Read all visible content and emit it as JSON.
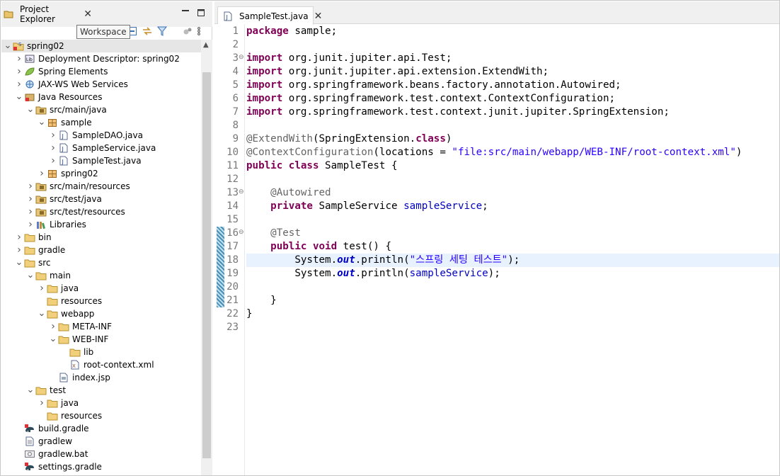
{
  "explorer": {
    "tab_label": "Project Explorer",
    "close_glyph": "✕",
    "tooltip": "Workspace",
    "tree": [
      {
        "label": "spring02",
        "depth": 0,
        "open": true,
        "icon": "project-icon",
        "selected": true
      },
      {
        "label": "Deployment Descriptor: spring02",
        "depth": 1,
        "open": false,
        "icon": "deployment-descriptor-icon"
      },
      {
        "label": "Spring Elements",
        "depth": 1,
        "open": false,
        "icon": "spring-leaf-icon"
      },
      {
        "label": "JAX-WS Web Services",
        "depth": 1,
        "open": false,
        "icon": "web-services-icon"
      },
      {
        "label": "Java Resources",
        "depth": 1,
        "open": true,
        "icon": "java-resources-icon"
      },
      {
        "label": "src/main/java",
        "depth": 2,
        "open": true,
        "icon": "source-folder-icon"
      },
      {
        "label": "sample",
        "depth": 3,
        "open": true,
        "icon": "package-icon"
      },
      {
        "label": "SampleDAO.java",
        "depth": 4,
        "open": false,
        "icon": "java-file-icon"
      },
      {
        "label": "SampleService.java",
        "depth": 4,
        "open": false,
        "icon": "java-file-icon"
      },
      {
        "label": "SampleTest.java",
        "depth": 4,
        "open": false,
        "icon": "java-file-icon"
      },
      {
        "label": "spring02",
        "depth": 3,
        "open": false,
        "icon": "package-icon"
      },
      {
        "label": "src/main/resources",
        "depth": 2,
        "open": false,
        "icon": "source-folder-icon"
      },
      {
        "label": "src/test/java",
        "depth": 2,
        "open": false,
        "icon": "source-folder-icon"
      },
      {
        "label": "src/test/resources",
        "depth": 2,
        "open": false,
        "icon": "source-folder-icon"
      },
      {
        "label": "Libraries",
        "depth": 2,
        "open": false,
        "icon": "libraries-icon"
      },
      {
        "label": "bin",
        "depth": 1,
        "open": false,
        "icon": "folder-icon"
      },
      {
        "label": "gradle",
        "depth": 1,
        "open": false,
        "icon": "folder-icon"
      },
      {
        "label": "src",
        "depth": 1,
        "open": true,
        "icon": "folder-icon"
      },
      {
        "label": "main",
        "depth": 2,
        "open": true,
        "icon": "folder-icon"
      },
      {
        "label": "java",
        "depth": 3,
        "open": false,
        "icon": "folder-icon"
      },
      {
        "label": "resources",
        "depth": 3,
        "leaf": true,
        "icon": "folder-icon"
      },
      {
        "label": "webapp",
        "depth": 3,
        "open": true,
        "icon": "folder-icon"
      },
      {
        "label": "META-INF",
        "depth": 4,
        "open": false,
        "icon": "folder-icon"
      },
      {
        "label": "WEB-INF",
        "depth": 4,
        "open": true,
        "icon": "folder-icon"
      },
      {
        "label": "lib",
        "depth": 5,
        "leaf": true,
        "icon": "folder-icon"
      },
      {
        "label": "root-context.xml",
        "depth": 5,
        "leaf": true,
        "icon": "xml-file-icon"
      },
      {
        "label": "index.jsp",
        "depth": 4,
        "leaf": true,
        "icon": "jsp-file-icon"
      },
      {
        "label": "test",
        "depth": 2,
        "open": true,
        "icon": "folder-icon"
      },
      {
        "label": "java",
        "depth": 3,
        "open": false,
        "icon": "folder-icon"
      },
      {
        "label": "resources",
        "depth": 3,
        "leaf": true,
        "icon": "folder-icon"
      },
      {
        "label": "build.gradle",
        "depth": 1,
        "leaf": true,
        "icon": "gradle-file-icon"
      },
      {
        "label": "gradlew",
        "depth": 1,
        "leaf": true,
        "icon": "text-file-icon"
      },
      {
        "label": "gradlew.bat",
        "depth": 1,
        "leaf": true,
        "icon": "bat-file-icon"
      },
      {
        "label": "settings.gradle",
        "depth": 1,
        "leaf": true,
        "icon": "gradle-file-icon"
      }
    ]
  },
  "editor": {
    "tab_label": "SampleTest.java",
    "close_glyph": "✕",
    "current_line": 18,
    "lines": [
      {
        "n": "1",
        "parts": [
          [
            "kw",
            "package"
          ],
          [
            "t",
            " sample;"
          ]
        ]
      },
      {
        "n": "2",
        "parts": []
      },
      {
        "n": "3",
        "fold": true,
        "parts": [
          [
            "kw",
            "import"
          ],
          [
            "t",
            " org.junit.jupiter.api.Test;"
          ]
        ]
      },
      {
        "n": "4",
        "parts": [
          [
            "kw",
            "import"
          ],
          [
            "t",
            " org.junit.jupiter.api.extension.ExtendWith;"
          ]
        ]
      },
      {
        "n": "5",
        "parts": [
          [
            "kw",
            "import"
          ],
          [
            "t",
            " org.springframework.beans.factory.annotation.Autowired;"
          ]
        ]
      },
      {
        "n": "6",
        "parts": [
          [
            "kw",
            "import"
          ],
          [
            "t",
            " org.springframework.test.context.ContextConfiguration;"
          ]
        ]
      },
      {
        "n": "7",
        "parts": [
          [
            "kw",
            "import"
          ],
          [
            "t",
            " org.springframework.test.context.junit.jupiter.SpringExtension;"
          ]
        ]
      },
      {
        "n": "8",
        "parts": []
      },
      {
        "n": "9",
        "parts": [
          [
            "an",
            "@ExtendWith"
          ],
          [
            "t",
            "(SpringExtension."
          ],
          [
            "kw",
            "class"
          ],
          [
            "t",
            ")"
          ]
        ]
      },
      {
        "n": "10",
        "parts": [
          [
            "an",
            "@ContextConfiguration"
          ],
          [
            "t",
            "(locations = "
          ],
          [
            "str",
            "\"file:src/main/webapp/WEB-INF/root-context.xml\""
          ],
          [
            "t",
            ")"
          ]
        ]
      },
      {
        "n": "11",
        "parts": [
          [
            "kw",
            "public"
          ],
          [
            "t",
            " "
          ],
          [
            "kw",
            "class"
          ],
          [
            "t",
            " SampleTest {"
          ]
        ]
      },
      {
        "n": "12",
        "parts": []
      },
      {
        "n": "13",
        "fold": true,
        "parts": [
          [
            "t",
            "    "
          ],
          [
            "an",
            "@Autowired"
          ]
        ]
      },
      {
        "n": "14",
        "parts": [
          [
            "t",
            "    "
          ],
          [
            "kw",
            "private"
          ],
          [
            "t",
            " SampleService "
          ],
          [
            "fld",
            "sampleService"
          ],
          [
            "t",
            ";"
          ]
        ]
      },
      {
        "n": "15",
        "parts": []
      },
      {
        "n": "16",
        "fold": true,
        "parts": [
          [
            "t",
            "    "
          ],
          [
            "an",
            "@Test"
          ]
        ]
      },
      {
        "n": "17",
        "parts": [
          [
            "t",
            "    "
          ],
          [
            "kw",
            "public"
          ],
          [
            "t",
            " "
          ],
          [
            "kw",
            "void"
          ],
          [
            "t",
            " test() {"
          ]
        ]
      },
      {
        "n": "18",
        "parts": [
          [
            "t",
            "        System."
          ],
          [
            "st",
            "out"
          ],
          [
            "t",
            ".println("
          ],
          [
            "str",
            "\"스프링 세팅 테스트\""
          ],
          [
            "t",
            ");"
          ]
        ]
      },
      {
        "n": "19",
        "parts": [
          [
            "t",
            "        System."
          ],
          [
            "st",
            "out"
          ],
          [
            "t",
            ".println("
          ],
          [
            "fld",
            "sampleService"
          ],
          [
            "t",
            ");"
          ]
        ]
      },
      {
        "n": "20",
        "parts": []
      },
      {
        "n": "21",
        "parts": [
          [
            "t",
            "    }"
          ]
        ]
      },
      {
        "n": "22",
        "parts": [
          [
            "t",
            "}"
          ]
        ]
      },
      {
        "n": "23",
        "parts": []
      }
    ]
  }
}
